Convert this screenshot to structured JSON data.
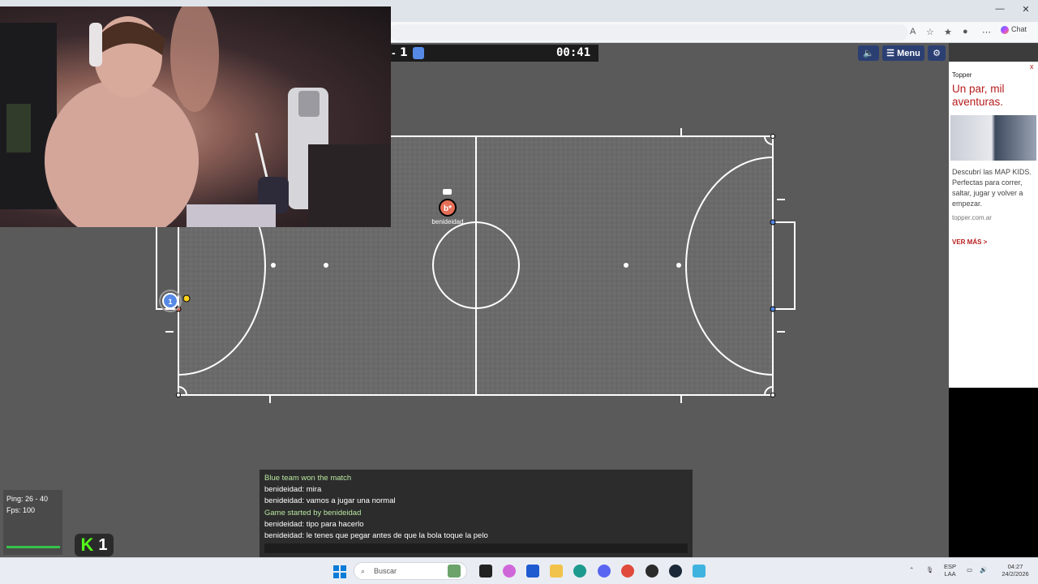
{
  "browser": {
    "minimize": "—",
    "maximize": "☐",
    "close": "✕",
    "chat_label": "Chat"
  },
  "hud": {
    "score_dash": "-",
    "score": "1",
    "timer": "00:41",
    "menu_label": "Menu"
  },
  "players": {
    "red_avatar": "b*",
    "red_name": "benideidad",
    "blue_avatar": "1"
  },
  "stats": {
    "ping": "Ping: 26 - 40",
    "fps": "Fps: 100"
  },
  "kick": {
    "logo": "K",
    "count": "1"
  },
  "chat": {
    "messages": [
      {
        "text": "Blue team won the match",
        "system": true
      },
      {
        "text": "benideidad: mira",
        "system": false
      },
      {
        "text": "benideidad: vamos a jugar una normal",
        "system": false
      },
      {
        "text": "Game started by benideidad",
        "system": true
      },
      {
        "text": "benideidad: tipo para hacerlo",
        "system": false
      },
      {
        "text": "benideidad: le tenes que pegar antes de que la bola toque la pelo",
        "system": false
      }
    ]
  },
  "ad": {
    "brand": "Topper",
    "headline": "Un par, mil aventuras.",
    "body": "Descubrí las MAP KIDS. Perfectas para correr, saltar, jugar y volver a empezar.",
    "url": "topper.com.ar",
    "cta": "VER MÁS >",
    "close": "x"
  },
  "taskbar": {
    "search_placeholder": "Buscar",
    "lang_top": "ESP",
    "lang_bottom": "LAA",
    "time": "04:27",
    "date": "24/2/2026"
  },
  "colors": {
    "field": "#5a5a5a",
    "red_team": "#e56e56",
    "blue_team": "#5689e5",
    "hud_button": "#2b3f73"
  }
}
